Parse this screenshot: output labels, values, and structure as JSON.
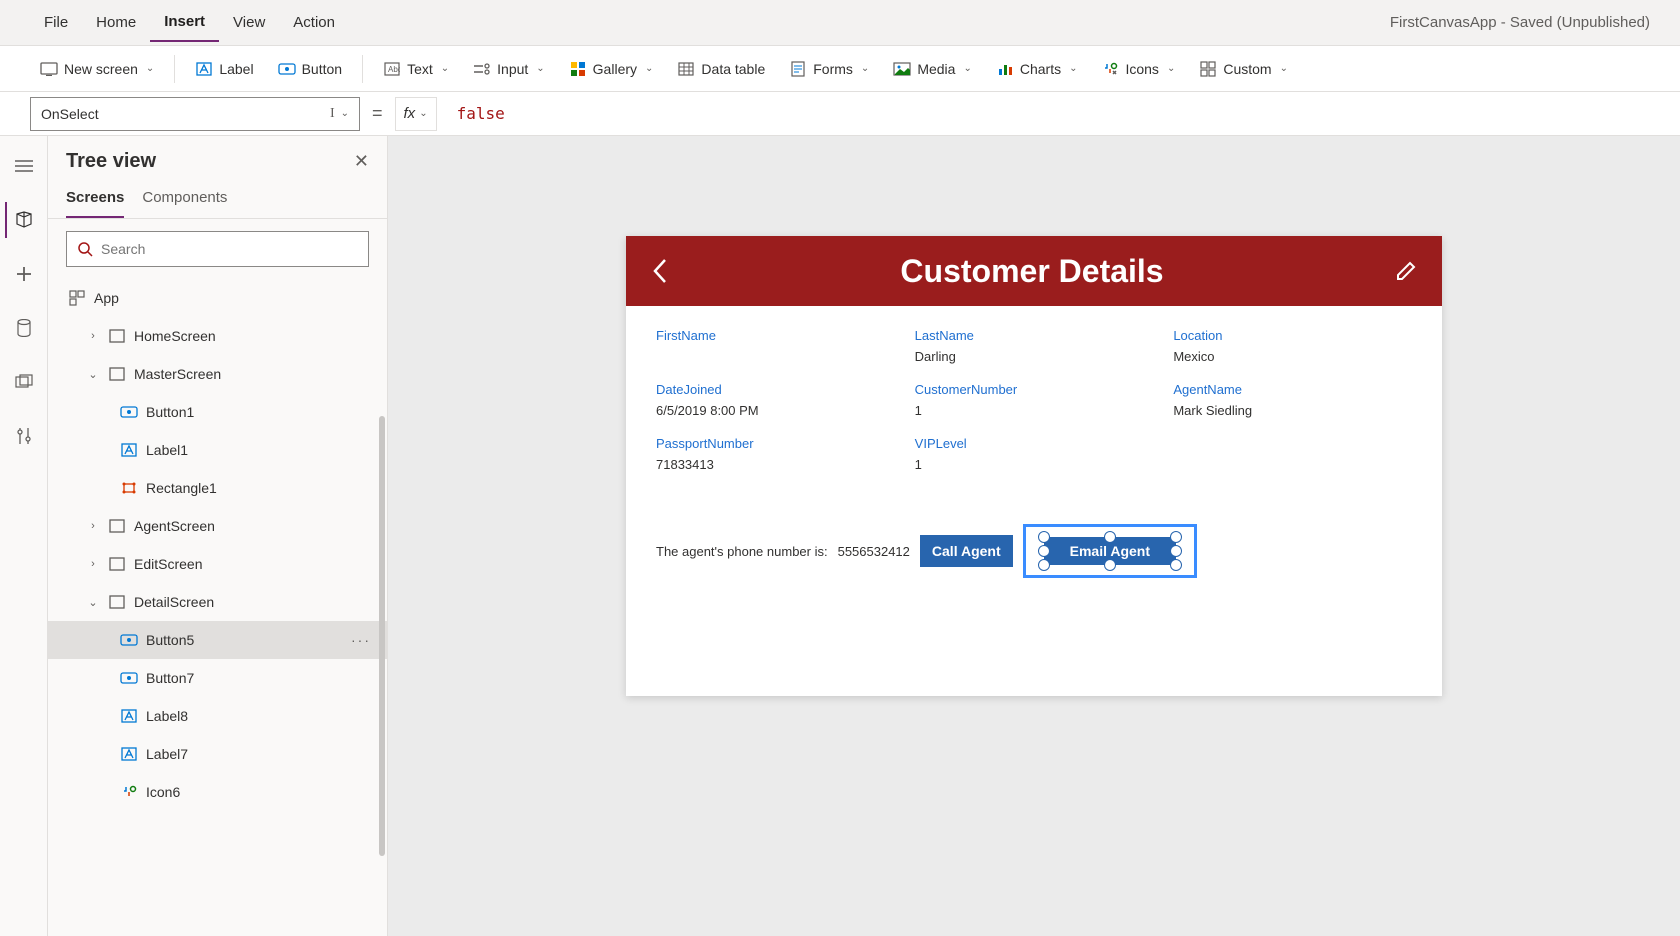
{
  "app_status": "FirstCanvasApp - Saved (Unpublished)",
  "menu": {
    "file": "File",
    "home": "Home",
    "insert": "Insert",
    "view": "View",
    "action": "Action"
  },
  "ribbon": {
    "new_screen": "New screen",
    "label": "Label",
    "button": "Button",
    "text": "Text",
    "input": "Input",
    "gallery": "Gallery",
    "data_table": "Data table",
    "forms": "Forms",
    "media": "Media",
    "charts": "Charts",
    "icons": "Icons",
    "custom": "Custom"
  },
  "formula": {
    "property": "OnSelect",
    "value": "false"
  },
  "tree": {
    "title": "Tree view",
    "tab_screens": "Screens",
    "tab_components": "Components",
    "search_placeholder": "Search",
    "app": "App",
    "items": [
      {
        "label": "HomeScreen",
        "depth": 1,
        "chev": "›",
        "icon": "screen"
      },
      {
        "label": "MasterScreen",
        "depth": 1,
        "chev": "⌄",
        "icon": "screen"
      },
      {
        "label": "Button1",
        "depth": 2,
        "icon": "button"
      },
      {
        "label": "Label1",
        "depth": 2,
        "icon": "label"
      },
      {
        "label": "Rectangle1",
        "depth": 2,
        "icon": "rect"
      },
      {
        "label": "AgentScreen",
        "depth": 1,
        "chev": "›",
        "icon": "screen"
      },
      {
        "label": "EditScreen",
        "depth": 1,
        "chev": "›",
        "icon": "screen"
      },
      {
        "label": "DetailScreen",
        "depth": 1,
        "chev": "⌄",
        "icon": "screen"
      },
      {
        "label": "Button5",
        "depth": 2,
        "icon": "button",
        "selected": true,
        "more": true
      },
      {
        "label": "Button7",
        "depth": 2,
        "icon": "button"
      },
      {
        "label": "Label8",
        "depth": 2,
        "icon": "label"
      },
      {
        "label": "Label7",
        "depth": 2,
        "icon": "label"
      },
      {
        "label": "Icon6",
        "depth": 2,
        "icon": "iconctrl"
      }
    ]
  },
  "canvas": {
    "header_title": "Customer Details",
    "fields": {
      "first_name_lbl": "FirstName",
      "last_name_lbl": "LastName",
      "last_name_val": "Darling",
      "location_lbl": "Location",
      "location_val": "Mexico",
      "date_joined_lbl": "DateJoined",
      "date_joined_val": "6/5/2019 8:00 PM",
      "cust_no_lbl": "CustomerNumber",
      "cust_no_val": "1",
      "agent_name_lbl": "AgentName",
      "agent_name_val": "Mark Siedling",
      "passport_lbl": "PassportNumber",
      "passport_val": "71833413",
      "vip_lbl": "VIPLevel",
      "vip_val": "1"
    },
    "agent_text": "The agent's phone number is:",
    "agent_phone": "5556532412",
    "call_btn": "Call Agent",
    "email_btn": "Email Agent"
  }
}
